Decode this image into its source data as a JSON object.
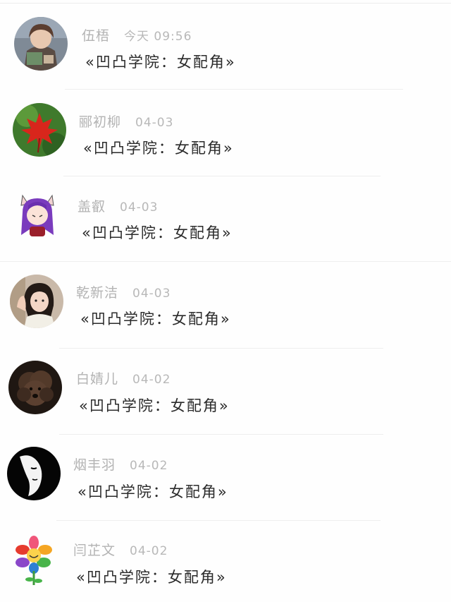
{
  "comments": [
    {
      "username": "伍梧",
      "time": "今天 09:56",
      "text": "«凹凸学院：女配角»",
      "avatar_icon": "anime-character-avatar-icon"
    },
    {
      "username": "郦初柳",
      "time": "04-03",
      "text": "«凹凸学院：女配角»",
      "avatar_icon": "red-maple-leaf-avatar-icon"
    },
    {
      "username": "盖叡",
      "time": "04-03",
      "text": "«凹凸学院：女配角»",
      "avatar_icon": "purple-hair-girl-avatar-icon"
    },
    {
      "username": "乾新洁",
      "time": "04-03",
      "text": "«凹凸学院：女配角»",
      "avatar_icon": "waving-girl-avatar-icon"
    },
    {
      "username": "白婧儿",
      "time": "04-02",
      "text": "«凹凸学院：女配角»",
      "avatar_icon": "brown-poodle-avatar-icon"
    },
    {
      "username": "烟丰羽",
      "time": "04-02",
      "text": "«凹凸学院：女配角»",
      "avatar_icon": "black-white-face-avatar-icon"
    },
    {
      "username": "闫芷文",
      "time": "04-02",
      "text": "«凹凸学院：女配角»",
      "avatar_icon": "rainbow-flower-avatar-icon"
    }
  ]
}
